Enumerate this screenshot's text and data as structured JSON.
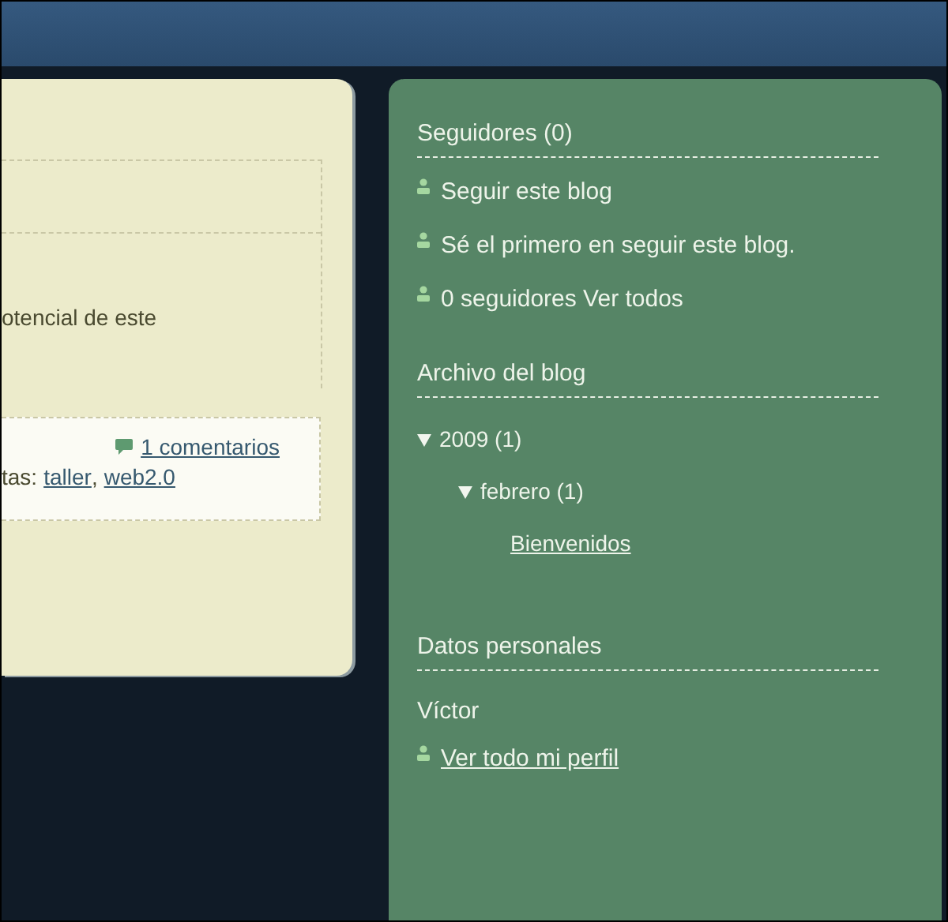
{
  "post": {
    "text": "otencial de este",
    "comments": "1 comentarios",
    "labels_prefix": "tas:",
    "labels": [
      "taller",
      "web2.0"
    ],
    "labels_separator": ","
  },
  "sidebar": {
    "followers": {
      "title": "Seguidores (0)",
      "items": [
        {
          "text": "Seguir este blog"
        },
        {
          "text": "Sé el primero en seguir este blog."
        },
        {
          "text": "0 seguidores Ver todos"
        }
      ]
    },
    "archive": {
      "title": "Archivo del blog",
      "tree": [
        {
          "label": "2009 (1)",
          "expanded": true,
          "children": [
            {
              "label": "febrero (1)",
              "expanded": true,
              "children": [
                {
                  "label": "Bienvenidos"
                }
              ]
            }
          ]
        }
      ]
    },
    "profile": {
      "title": "Datos personales",
      "name": "Víctor",
      "link": "Ver todo mi perfil"
    }
  }
}
